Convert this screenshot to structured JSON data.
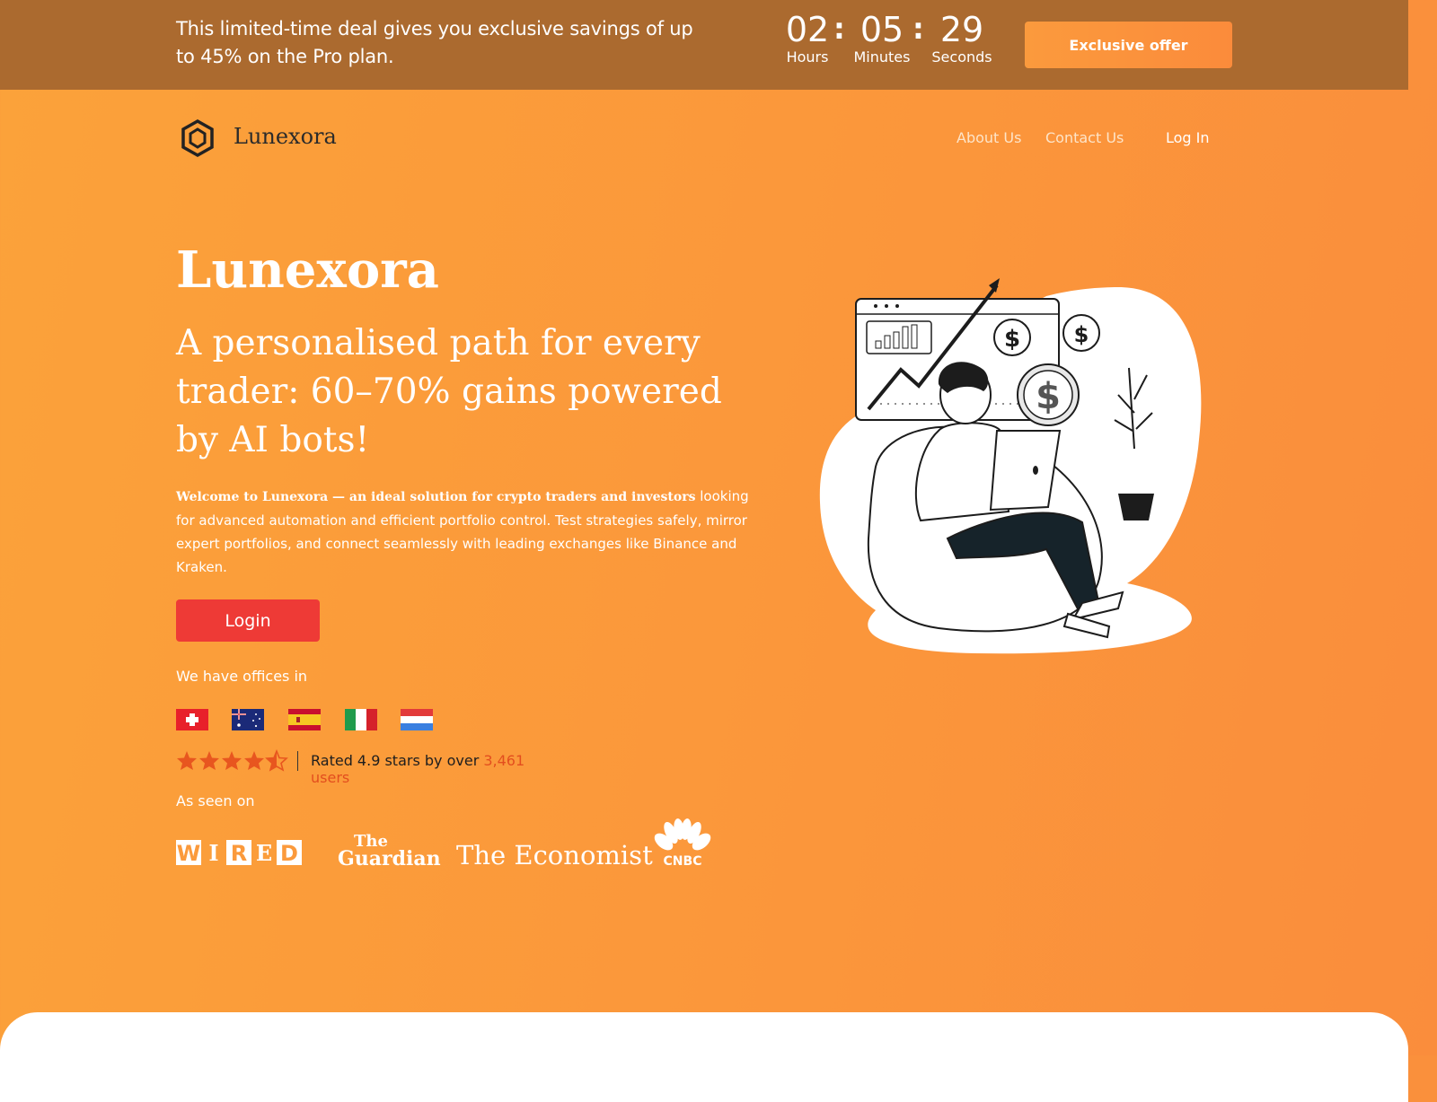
{
  "promo": {
    "text": "This limited-time deal gives you exclusive savings of up to 45% on the Pro plan.",
    "timer": {
      "hours": "02",
      "hours_label": "Hours",
      "minutes": "05",
      "minutes_label": "Minutes",
      "seconds": "29",
      "seconds_label": "Seconds"
    },
    "button_label": "Exclusive offer"
  },
  "header": {
    "brand": "Lunexora",
    "nav": {
      "about": "About Us",
      "contact": "Contact Us",
      "login": "Log In"
    }
  },
  "hero": {
    "title": "Lunexora",
    "subtitle": "A personalised path for every trader: 60–70% gains powered by AI bots!",
    "desc_bold": "Welcome to Lunexora — an ideal solution for crypto traders and investors",
    "desc_rest": " looking for advanced automation and efficient portfolio control. Test strategies safely, mirror expert portfolios, and connect seamlessly with leading exchanges like Binance and Kraken.",
    "login_button": "Login",
    "offices_label": "We have offices in",
    "flags": [
      "switzerland-flag",
      "australia-flag",
      "spain-flag",
      "italy-flag",
      "netherlands-flag"
    ],
    "rating": {
      "stars": 4.5,
      "text": "Rated 4.9 stars by over ",
      "users": "3,461 users"
    },
    "seen_label": "As seen on",
    "press": {
      "wired": "WIRED",
      "guardian_line1": "The",
      "guardian_line2": "Guardian",
      "economist": "The Economist",
      "cnbc": "CNBC"
    }
  },
  "colors": {
    "banner": "#ab6a2f",
    "background": "#fb9a3c",
    "login_button": "#ee3a36",
    "star": "#e8561f"
  }
}
